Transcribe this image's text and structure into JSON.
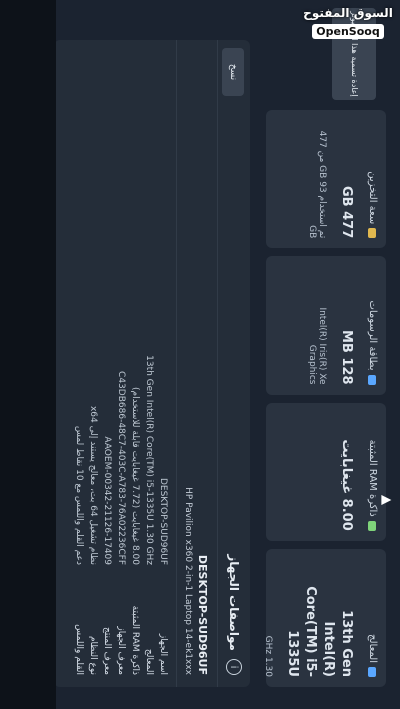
{
  "watermark": {
    "arabic": "السوق المفتوح",
    "brand": "OpenSooq"
  },
  "cards": [
    {
      "title": "المعالج",
      "value": "13th Gen Intel(R) Core(TM) i5-1335U",
      "sub": "1.30 GHz",
      "icon_color": "#5aa7ff"
    },
    {
      "title": "ذاكرة RAM المثبتة",
      "value": "8.00 غيغابايت",
      "sub": "",
      "icon_color": "#7fd37a"
    },
    {
      "title": "بطاقة الرسومات",
      "value": "128 MB",
      "sub": "Intel(R) Iris(R) Xe Graphics",
      "icon_color": "#5aa7ff"
    },
    {
      "title": "سعة التخزين",
      "value": "477 GB",
      "sub": "تم استخدام 93 GB من 477 GB",
      "icon_color": "#e0b84f"
    }
  ],
  "spec": {
    "title": "مواصفات الجهاز",
    "copy_label": "نسخ",
    "device_name": "DESKTOP-SUD96UF",
    "device_model": "HP Pavilion x360 2-in-1 Laptop 14-ek1xxx",
    "rows": [
      {
        "label": "اسم الجهاز",
        "value": "DESKTOP-SUD96UF"
      },
      {
        "label": "المعالج",
        "value": "13th Gen Intel(R) Core(TM) i5-1335U   1.30 GHz"
      },
      {
        "label": "ذاكرة RAM المثبتة",
        "value": "8.00 غيغابايت (7.72 غيغابايت قابلة للاستخدام)"
      },
      {
        "label": "معرف الجهاز",
        "value": "C43DB686-48C7-403C-A783-76A02236CFF"
      },
      {
        "label": "معرف المنتج",
        "value": "00342-21126-17409-AAOEM"
      },
      {
        "label": "نوع النظام",
        "value": "نظام تشغيل 64 بت، معالج يستند إلى x64"
      },
      {
        "label": "القلم واللمس",
        "value": "دعم القلم واللمس مع 10 نقاط لمس"
      }
    ]
  },
  "rename_label": "إعادة تسمية هذا الكمبيوتر"
}
